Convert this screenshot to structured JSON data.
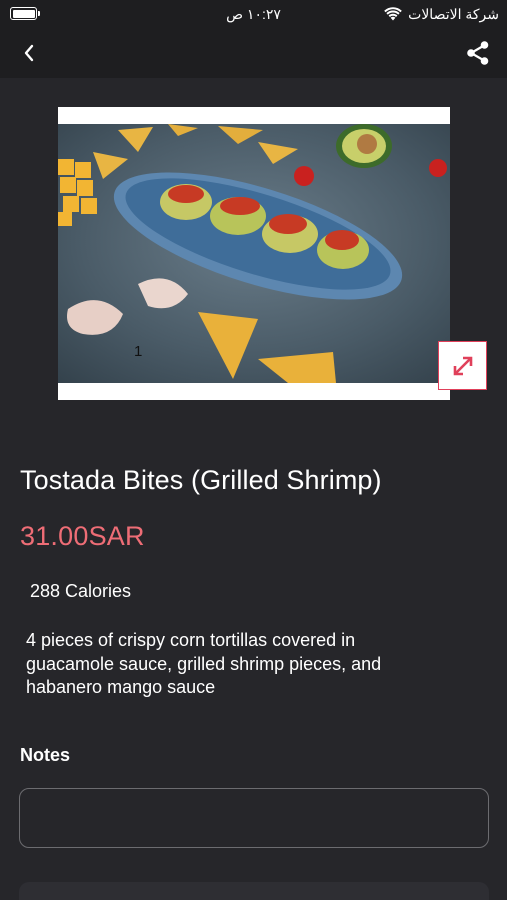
{
  "status_bar": {
    "time": "١٠:٢٧ ص",
    "carrier": "شركة الاتصالات"
  },
  "header": {
    "back_icon": "chevron-left-icon",
    "share_icon": "share-icon"
  },
  "product": {
    "image_marker": "1",
    "name": "Tostada Bites (Grilled Shrimp)",
    "price": "31.00SAR",
    "calories": "288 Calories",
    "description": "4 pieces of crispy corn tortillas covered in guacamole sauce, grilled shrimp pieces, and habanero mango sauce",
    "expand_icon": "expand-arrows-icon"
  },
  "notes": {
    "label": "Notes",
    "value": "",
    "placeholder": ""
  },
  "colors": {
    "background": "#26262a",
    "bar": "#1e1e20",
    "price": "#ee6d76",
    "accent": "#e0405a"
  }
}
